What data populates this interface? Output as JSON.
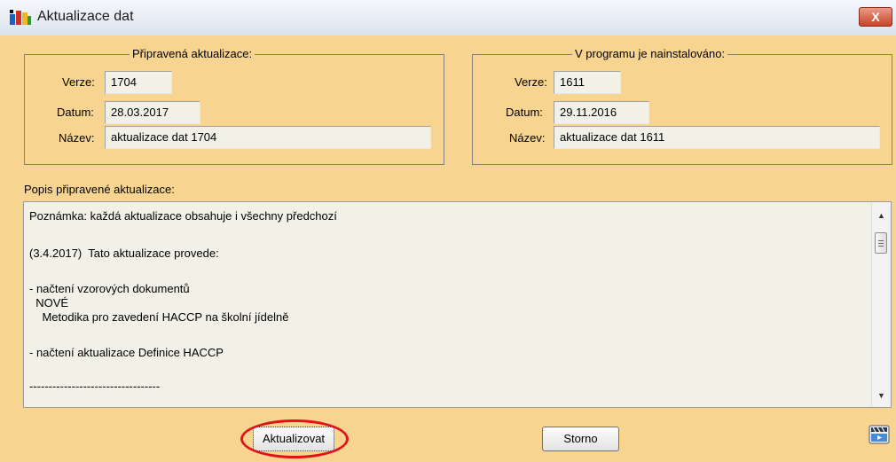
{
  "window": {
    "title": "Aktualizace dat",
    "close_glyph": "X"
  },
  "prepared": {
    "legend": "Připravená aktualizace:",
    "version_label": "Verze:",
    "version": "1704",
    "date_label": "Datum:",
    "date": "28.03.2017",
    "name_label": "Název:",
    "name": "aktualizace dat 1704"
  },
  "installed": {
    "legend": "V programu je nainstalováno:",
    "version_label": "Verze:",
    "version": "1611",
    "date_label": "Datum:",
    "date": "29.11.2016",
    "name_label": "Název:",
    "name": "aktualizace dat 1611"
  },
  "description": {
    "label": "Popis připravené aktualizace:",
    "lines": [
      "Poznámka: každá aktualizace obsahuje i všechny předchozí",
      "",
      "(3.4.2017)  Tato aktualizace provede:",
      "",
      "- načtení vzorových dokumentů",
      "  NOVÉ",
      "    Metodika pro zavedení HACCP na školní jídelně",
      "",
      "- načtení aktualizace Definice HACCP",
      "",
      "----------------------------------"
    ]
  },
  "buttons": {
    "update_label": "Aktualizovat",
    "cancel_label": "Storno"
  },
  "icons": {
    "title_icon": "app-logo-icon",
    "help_icon": "clapperboard-icon",
    "highlight_color": "#e0141a"
  }
}
